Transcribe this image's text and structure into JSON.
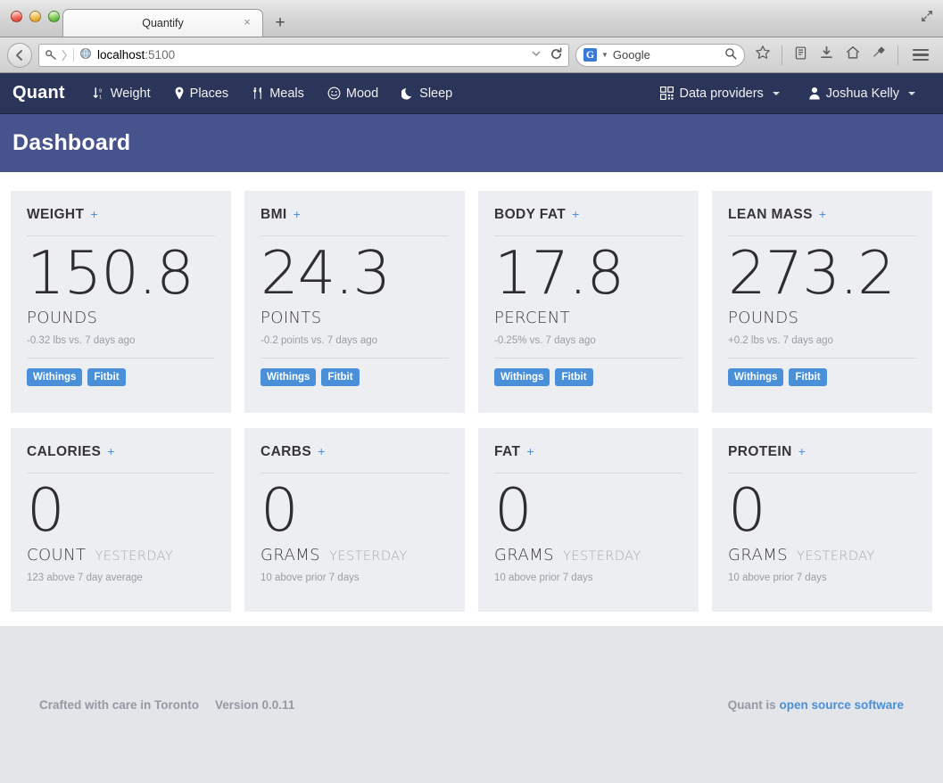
{
  "browser": {
    "tab_title": "Quantify",
    "tab_close_glyph": "×",
    "new_tab_glyph": "+",
    "url": "localhost",
    "url_port": ":5100",
    "search_engine": "G",
    "search_placeholder": "Google",
    "icons": {
      "back": "back-icon",
      "key": "key-icon",
      "globe": "globe-icon",
      "dropdown": "chevron-down-icon",
      "reload": "reload-icon",
      "search": "search-icon",
      "bookmark": "star-icon",
      "reader": "reader-list-icon",
      "downloads": "download-icon",
      "home": "home-icon",
      "pocket": "pocket-icon",
      "menu": "hamburger-menu-icon",
      "maximize": "maximize-icon"
    }
  },
  "navbar": {
    "brand": "Quant",
    "links": [
      {
        "label": "Weight",
        "icon": "sort-numeric-icon"
      },
      {
        "label": "Places",
        "icon": "map-pin-icon"
      },
      {
        "label": "Meals",
        "icon": "cutlery-icon"
      },
      {
        "label": "Mood",
        "icon": "smiley-icon"
      },
      {
        "label": "Sleep",
        "icon": "moon-icon"
      }
    ],
    "data_providers": "Data providers",
    "user": "Joshua Kelly"
  },
  "page_header": {
    "title": "Dashboard"
  },
  "cards_row1": [
    {
      "title": "WEIGHT",
      "plus": "+",
      "value": "150.8",
      "unit": "POUNDS",
      "delta": "-0.32 lbs vs. 7 days ago",
      "badges": [
        "Withings",
        "Fitbit"
      ]
    },
    {
      "title": "BMI",
      "plus": "+",
      "value": "24.3",
      "unit": "POINTS",
      "delta": "-0.2 points vs. 7 days ago",
      "badges": [
        "Withings",
        "Fitbit"
      ]
    },
    {
      "title": "BODY FAT",
      "plus": "+",
      "value": "17.8",
      "unit": "PERCENT",
      "delta": "-0.25% vs. 7 days ago",
      "badges": [
        "Withings",
        "Fitbit"
      ]
    },
    {
      "title": "LEAN MASS",
      "plus": "+",
      "value": "273.2",
      "unit": "POUNDS",
      "delta": "+0.2 lbs vs. 7 days ago",
      "badges": [
        "Withings",
        "Fitbit"
      ]
    }
  ],
  "cards_row2": [
    {
      "title": "CALORIES",
      "plus": "+",
      "value": "0",
      "unit": "COUNT",
      "period": "YESTERDAY",
      "delta": "123 above 7 day average"
    },
    {
      "title": "CARBS",
      "plus": "+",
      "value": "0",
      "unit": "GRAMS",
      "period": "YESTERDAY",
      "delta": "10 above prior 7 days"
    },
    {
      "title": "FAT",
      "plus": "+",
      "value": "0",
      "unit": "GRAMS",
      "period": "YESTERDAY",
      "delta": "10 above prior 7 days"
    },
    {
      "title": "PROTEIN",
      "plus": "+",
      "value": "0",
      "unit": "GRAMS",
      "period": "YESTERDAY",
      "delta": "10 above prior 7 days"
    }
  ],
  "footer": {
    "crafted": "Crafted with care in Toronto",
    "version": "Version 0.0.11",
    "right_prefix": "Quant is ",
    "right_link": "open source software"
  },
  "colors": {
    "navbar": "#2b3459",
    "page_header": "#47538c",
    "accent": "#4a90d9",
    "card_bg": "#edeef1",
    "footer_bg": "#e3e5e9"
  }
}
